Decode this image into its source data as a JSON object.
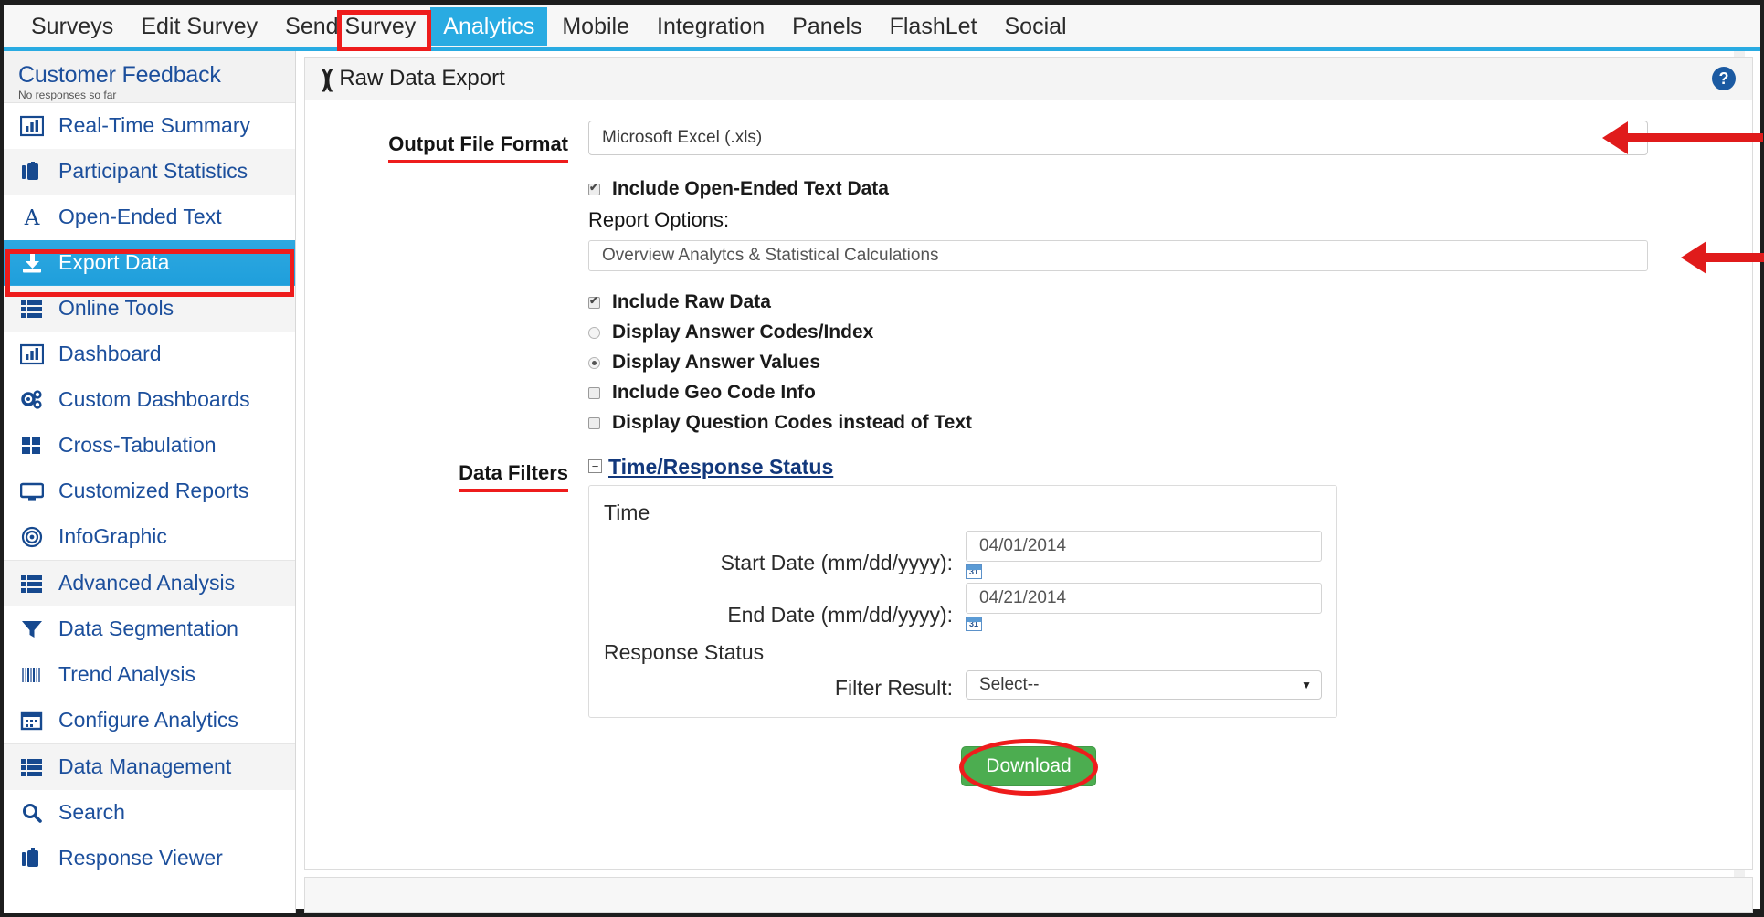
{
  "topnav": {
    "tabs": [
      {
        "label": "Surveys",
        "active": false
      },
      {
        "label": "Edit Survey",
        "active": false
      },
      {
        "label": "Send Survey",
        "active": false
      },
      {
        "label": "Analytics",
        "active": true
      },
      {
        "label": "Mobile",
        "active": false
      },
      {
        "label": "Integration",
        "active": false
      },
      {
        "label": "Panels",
        "active": false
      },
      {
        "label": "FlashLet",
        "active": false
      },
      {
        "label": "Social",
        "active": false
      }
    ],
    "active_tab": "Analytics",
    "highlight_color": "#ee1c1c",
    "active_bg": "#29abe2"
  },
  "sidebar": {
    "title": "Customer Feedback",
    "subtitle": "No responses so far",
    "selected_item": "Export Data",
    "items": [
      {
        "label": "Real-Time Summary",
        "icon": "bar-chart-icon"
      },
      {
        "label": "Participant Statistics",
        "icon": "briefcase-icon"
      },
      {
        "label": "Open-Ended Text",
        "icon": "letter-a-icon"
      },
      {
        "label": "Export Data",
        "icon": "download-icon"
      },
      {
        "label": "Online Tools",
        "icon": "list-icon"
      },
      {
        "label": "Dashboard",
        "icon": "bar-chart-icon"
      },
      {
        "label": "Custom Dashboards",
        "icon": "gears-icon"
      },
      {
        "label": "Cross-Tabulation",
        "icon": "grid-icon"
      },
      {
        "label": "Customized Reports",
        "icon": "monitor-icon"
      },
      {
        "label": "InfoGraphic",
        "icon": "target-icon"
      },
      {
        "label": "Advanced Analysis",
        "icon": "list-icon"
      },
      {
        "label": "Data Segmentation",
        "icon": "funnel-icon"
      },
      {
        "label": "Trend Analysis",
        "icon": "bars-icon"
      },
      {
        "label": "Configure Analytics",
        "icon": "calendar-icon"
      },
      {
        "label": "Data Management",
        "icon": "list-icon"
      },
      {
        "label": "Search",
        "icon": "search-icon"
      },
      {
        "label": "Response Viewer",
        "icon": "briefcase-icon"
      }
    ]
  },
  "panel": {
    "title": "Raw Data Export",
    "icon": "chevrons-icon",
    "help_icon": "help-icon",
    "help_glyph": "?"
  },
  "form": {
    "output_format": {
      "annotation": "Output File Format",
      "value": "Microsoft Excel (.xls)",
      "caret": "▼"
    },
    "include_open_ended": {
      "label": "Include Open-Ended Text Data",
      "checked": true
    },
    "report_options_label": "Report Options:",
    "report_options_value": "Overview Analytcs & Statistical Calculations",
    "options": [
      {
        "label": "Include Raw Data",
        "type": "checkbox",
        "checked": true
      },
      {
        "label": "Display Answer Codes/Index",
        "type": "radio",
        "checked": false
      },
      {
        "label": "Display Answer Values",
        "type": "radio",
        "checked": true
      },
      {
        "label": "Include Geo Code Info",
        "type": "checkbox",
        "checked": false
      },
      {
        "label": "Display Question Codes instead of Text",
        "type": "checkbox",
        "checked": false
      }
    ],
    "data_filters": {
      "annotation": "Data Filters",
      "section_title": "Time/Response Status",
      "collapse_glyph": "−",
      "time_heading": "Time",
      "start_date_label": "Start Date (mm/dd/yyyy):",
      "start_date_value": "04/01/2014",
      "end_date_label": "End Date (mm/dd/yyyy):",
      "end_date_value": "04/21/2014",
      "calendar_icon_day": "31",
      "response_status_heading": "Response Status",
      "filter_result_label": "Filter Result:",
      "filter_result_value": "Select--",
      "filter_result_caret": "▼"
    },
    "download_label": "Download",
    "download_color": "#4cad50"
  }
}
